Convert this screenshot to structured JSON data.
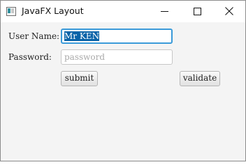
{
  "window": {
    "title": "JavaFX Layout"
  },
  "form": {
    "username_label": "User Name:",
    "username_value": "Mr KEN",
    "password_label": "Password:",
    "password_placeholder": "password",
    "submit_label": "submit",
    "validate_label": "validate"
  },
  "colors": {
    "focus_border": "#3a9ad9",
    "selection_bg": "#0a63a8",
    "window_bg": "#f4f4f4"
  }
}
